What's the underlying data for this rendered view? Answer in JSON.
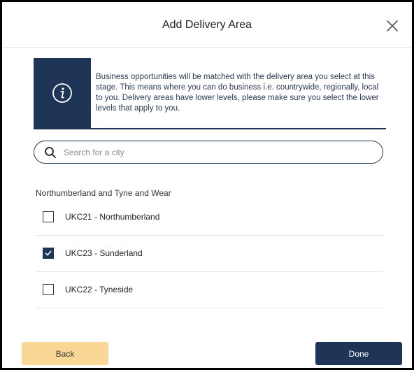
{
  "modal": {
    "title": "Add Delivery Area",
    "close_icon": "close-icon"
  },
  "info": {
    "icon": "info-icon",
    "text": "Business opportunities will be matched with the delivery area you select at this stage. This means where you can do business i.e. countrywide, regionally, local to you. Delivery areas have lower levels, please make sure you select the lower levels that apply to you.",
    "accent_color": "#1f3557"
  },
  "search": {
    "placeholder": "Search for a city",
    "value": "",
    "icon": "search-icon"
  },
  "group": {
    "label": "Northumberland and Tyne and Wear",
    "items": [
      {
        "label": "UKC21 - Northumberland",
        "checked": false
      },
      {
        "label": "UKC23 - Sunderland",
        "checked": true
      },
      {
        "label": "UKC22 - Tyneside",
        "checked": false
      }
    ]
  },
  "footer": {
    "back_label": "Back",
    "done_label": "Done",
    "back_color": "#f9d895",
    "done_color": "#1f3557"
  }
}
